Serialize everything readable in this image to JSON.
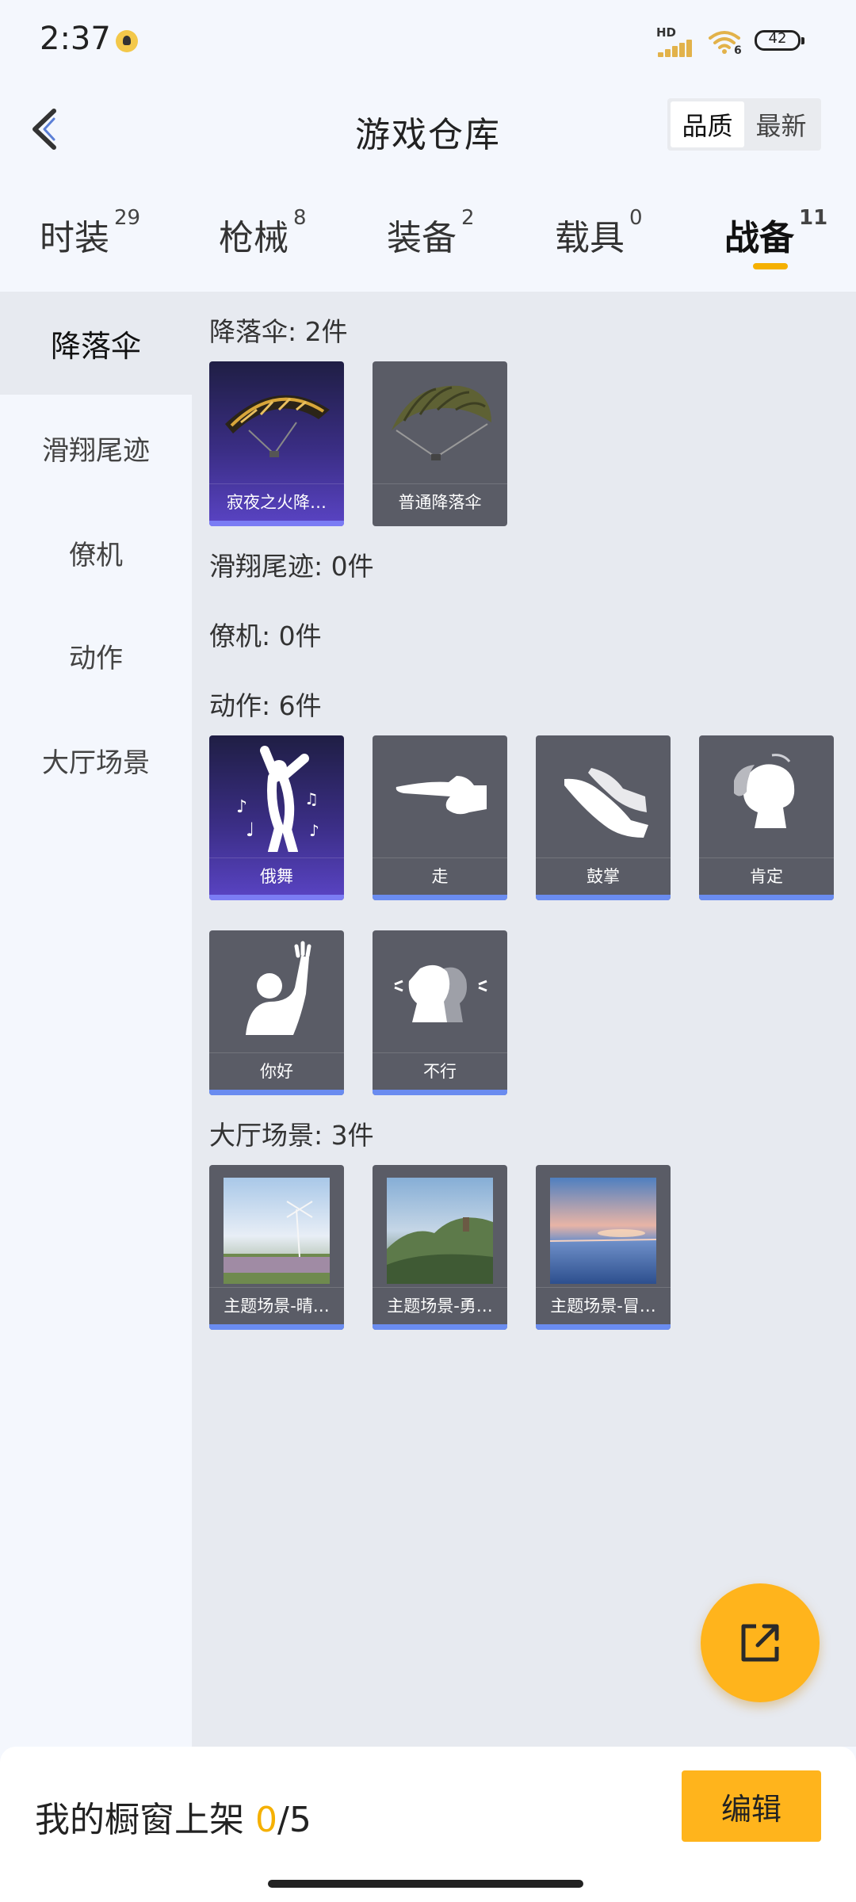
{
  "status_bar": {
    "time": "2:37",
    "network_label": "HD",
    "wifi_label": "6",
    "battery": "42"
  },
  "header": {
    "title": "游戏仓库",
    "sort_options": [
      "品质",
      "最新"
    ]
  },
  "tabs": [
    {
      "label": "时装",
      "count": "29"
    },
    {
      "label": "枪械",
      "count": "8"
    },
    {
      "label": "装备",
      "count": "2"
    },
    {
      "label": "载具",
      "count": "0"
    },
    {
      "label": "战备",
      "count": "11"
    }
  ],
  "sidebar": {
    "items": [
      "降落伞",
      "滑翔尾迹",
      "僚机",
      "动作",
      "大厅场景"
    ]
  },
  "sections": {
    "parachute": {
      "title": "降落伞: 2件",
      "items": [
        {
          "name": "寂夜之火降…",
          "quality": "legendary"
        },
        {
          "name": "普通降落伞",
          "quality": "normal"
        }
      ]
    },
    "glide_trail": {
      "title": "滑翔尾迹: 0件"
    },
    "wingman": {
      "title": "僚机: 0件"
    },
    "emotes": {
      "title": "动作: 6件",
      "items": [
        {
          "name": "俄舞",
          "quality": "legendary"
        },
        {
          "name": "走",
          "quality": "normal"
        },
        {
          "name": "鼓掌",
          "quality": "normal"
        },
        {
          "name": "肯定",
          "quality": "normal"
        },
        {
          "name": "你好",
          "quality": "normal"
        },
        {
          "name": "不行",
          "quality": "normal"
        }
      ]
    },
    "lobby_scene": {
      "title": "大厅场景: 3件",
      "items": [
        {
          "name": "主题场景-晴…",
          "quality": "normal"
        },
        {
          "name": "主题场景-勇…",
          "quality": "normal"
        },
        {
          "name": "主题场景-冒…",
          "quality": "normal"
        }
      ]
    }
  },
  "bottom_bar": {
    "shelf_label": "我的橱窗上架",
    "shelf_current": "0",
    "shelf_total": "/5",
    "edit_label": "编辑"
  },
  "colors": {
    "accent": "#ffb41c",
    "legendary_bar": "#7b7cf4",
    "normal_bar": "#6a8cf0"
  },
  "icons": {
    "back": "chevron-left-icon",
    "share": "share-external-icon"
  }
}
